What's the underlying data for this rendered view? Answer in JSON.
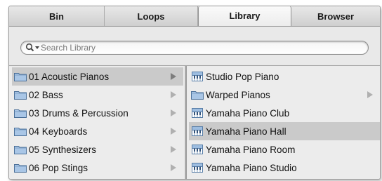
{
  "tabs": [
    {
      "label": "Bin"
    },
    {
      "label": "Loops"
    },
    {
      "label": "Library"
    },
    {
      "label": "Browser"
    }
  ],
  "active_tab": 2,
  "search": {
    "placeholder": "Search Library",
    "value": ""
  },
  "left_column": {
    "items": [
      {
        "label": "01 Acoustic Pianos",
        "icon": "folder-icon",
        "selected": true
      },
      {
        "label": "02 Bass",
        "icon": "folder-icon"
      },
      {
        "label": "03 Drums & Percussion",
        "icon": "folder-icon"
      },
      {
        "label": "04 Keyboards",
        "icon": "folder-icon"
      },
      {
        "label": "05 Synthesizers",
        "icon": "folder-icon"
      },
      {
        "label": "06 Pop Stings",
        "icon": "folder-icon"
      }
    ]
  },
  "right_column": {
    "items": [
      {
        "label": "Studio Pop Piano",
        "icon": "patch-icon"
      },
      {
        "label": "Warped Pianos",
        "icon": "folder-icon",
        "has_children": true
      },
      {
        "label": "Yamaha Piano Club",
        "icon": "patch-icon"
      },
      {
        "label": "Yamaha Piano Hall",
        "icon": "patch-icon",
        "selected": true
      },
      {
        "label": "Yamaha Piano Room",
        "icon": "patch-icon"
      },
      {
        "label": "Yamaha Piano Studio",
        "icon": "patch-icon"
      }
    ]
  },
  "colors": {
    "selection": "#cacaca",
    "folder_fill": "#a9c6e6",
    "panel": "#e6e6e6"
  }
}
